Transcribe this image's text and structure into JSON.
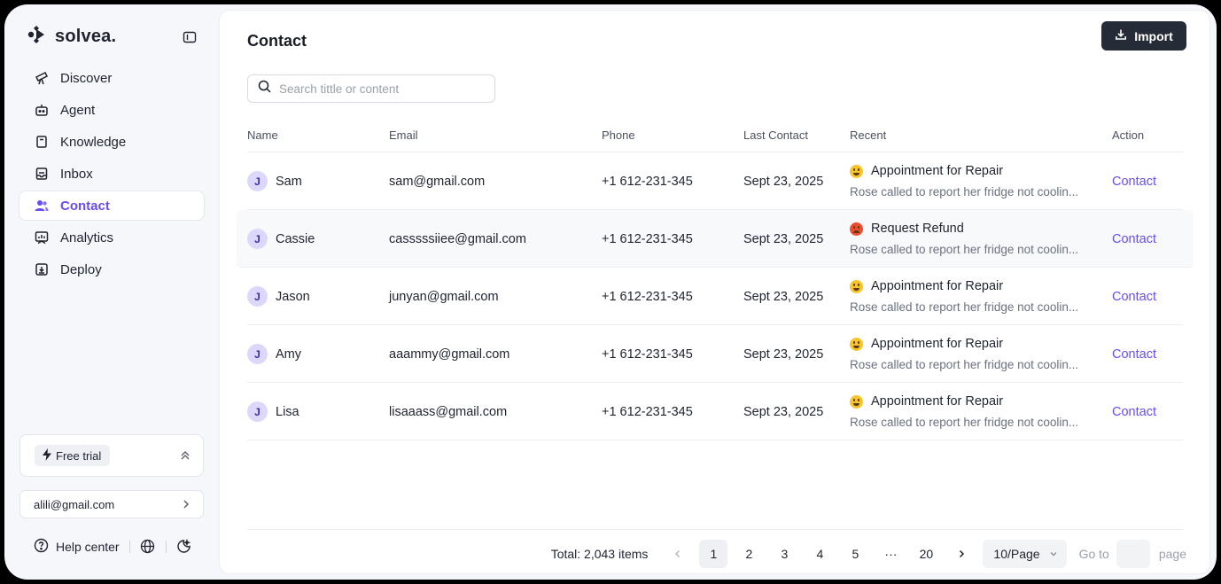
{
  "brand": {
    "name": "solvea."
  },
  "nav": [
    {
      "label": "Discover",
      "icon": "telescope-icon",
      "active": false
    },
    {
      "label": "Agent",
      "icon": "robot-icon",
      "active": false
    },
    {
      "label": "Knowledge",
      "icon": "book-icon",
      "active": false
    },
    {
      "label": "Inbox",
      "icon": "inbox-icon",
      "active": false
    },
    {
      "label": "Contact",
      "icon": "users-icon",
      "active": true
    },
    {
      "label": "Analytics",
      "icon": "analytics-icon",
      "active": false
    },
    {
      "label": "Deploy",
      "icon": "deploy-icon",
      "active": false
    }
  ],
  "trial": {
    "label": "Free trial"
  },
  "account": {
    "email": "alili@gmail.com"
  },
  "footer": {
    "help_label": "Help center"
  },
  "page": {
    "title": "Contact",
    "import_label": "Import"
  },
  "search": {
    "placeholder": "Search tittle or content"
  },
  "table": {
    "columns": [
      "Name",
      "Email",
      "Phone",
      "Last Contact",
      "Recent",
      "Action"
    ],
    "rows": [
      {
        "initial": "J",
        "name": "Sam",
        "email": "sam@gmail.com",
        "phone": "+1 612-231-345",
        "last_contact": "Sept 23, 2025",
        "mood": "happy",
        "recent_title": "Appointment for Repair",
        "recent_desc": "Rose called to report her fridge not coolin...",
        "action": "Contact"
      },
      {
        "initial": "J",
        "name": "Cassie",
        "email": "casssssiiee@gmail.com",
        "phone": "+1 612-231-345",
        "last_contact": "Sept 23, 2025",
        "mood": "angry",
        "recent_title": "Request Refund",
        "recent_desc": "Rose called to report her fridge not coolin...",
        "action": "Contact"
      },
      {
        "initial": "J",
        "name": "Jason",
        "email": "junyan@gmail.com",
        "phone": "+1 612-231-345",
        "last_contact": "Sept 23, 2025",
        "mood": "happy",
        "recent_title": "Appointment for Repair",
        "recent_desc": "Rose called to report her fridge not coolin...",
        "action": "Contact"
      },
      {
        "initial": "J",
        "name": "Amy",
        "email": "aaammy@gmail.com",
        "phone": "+1 612-231-345",
        "last_contact": "Sept 23, 2025",
        "mood": "happy",
        "recent_title": "Appointment for Repair",
        "recent_desc": "Rose called to report her fridge not coolin...",
        "action": "Contact"
      },
      {
        "initial": "J",
        "name": "Lisa",
        "email": "lisaaass@gmail.com",
        "phone": "+1 612-231-345",
        "last_contact": "Sept 23, 2025",
        "mood": "happy",
        "recent_title": "Appointment for Repair",
        "recent_desc": "Rose called to report her fridge not coolin...",
        "action": "Contact"
      }
    ]
  },
  "pagination": {
    "total": "Total: 2,043 items",
    "pages": [
      "1",
      "2",
      "3",
      "4",
      "5",
      "···",
      "20"
    ],
    "current": "1",
    "page_size": "10/Page",
    "goto_label": "Go to",
    "page_label": "page"
  },
  "colors": {
    "accent": "#6a4cf5",
    "dark_button": "#262b38",
    "avatar_bg": "#dcd8fb"
  }
}
